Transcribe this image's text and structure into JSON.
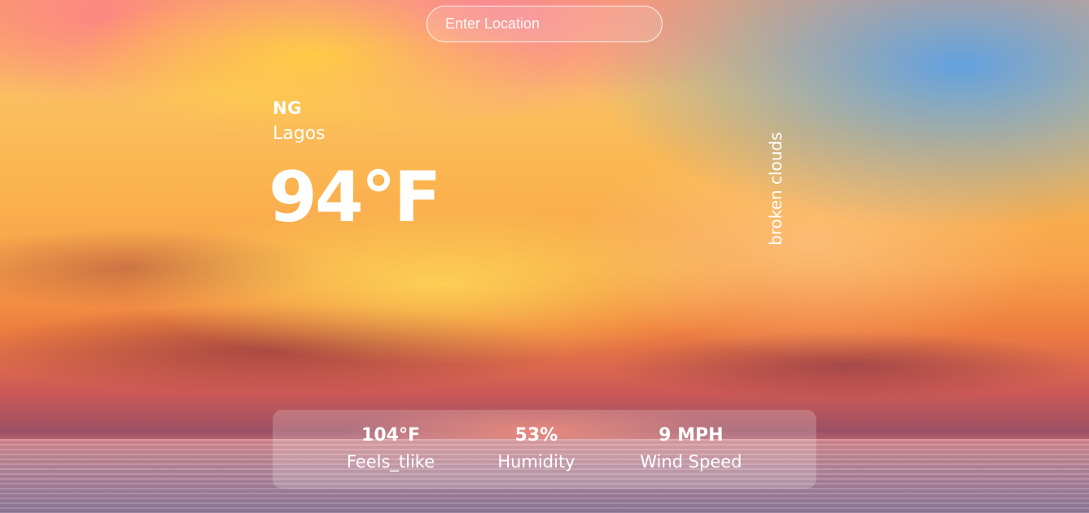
{
  "search": {
    "placeholder": "Enter Location",
    "value": ""
  },
  "location": {
    "country": "NG",
    "city": "Lagos"
  },
  "weather": {
    "temperature": "94°F",
    "description": "broken clouds"
  },
  "stats": [
    {
      "value": "104°F",
      "label": "Feels_tlike"
    },
    {
      "value": "53%",
      "label": "Humidity"
    },
    {
      "value": "9 MPH",
      "label": "Wind Speed"
    }
  ],
  "colors": {
    "text": "#ffffff",
    "panel": "rgba(255,255,255,0.2)"
  }
}
